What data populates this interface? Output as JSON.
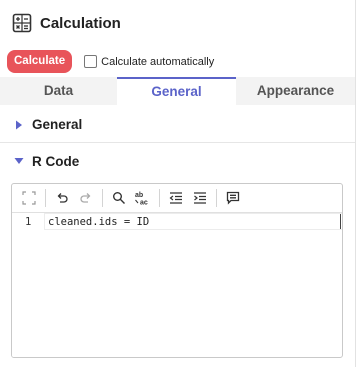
{
  "header": {
    "title": "Calculation",
    "icon": "calculator-icon"
  },
  "actions": {
    "calculate_label": "Calculate",
    "auto_label": "Calculate automatically",
    "auto_checked": false
  },
  "tabs": [
    {
      "label": "Data",
      "active": false
    },
    {
      "label": "General",
      "active": true
    },
    {
      "label": "Appearance",
      "active": false
    }
  ],
  "sections": [
    {
      "label": "General",
      "expanded": false
    },
    {
      "label": "R Code",
      "expanded": true
    }
  ],
  "editor": {
    "toolbar": [
      "fullscreen-icon",
      "undo-icon",
      "redo-icon",
      "search-icon",
      "replace-icon",
      "outdent-icon",
      "indent-icon",
      "comment-icon"
    ],
    "lines": [
      {
        "number": "1",
        "text": "cleaned.ids = ID"
      }
    ]
  },
  "colors": {
    "accent": "#5b63c9",
    "calculate_button": "#e8545a"
  }
}
